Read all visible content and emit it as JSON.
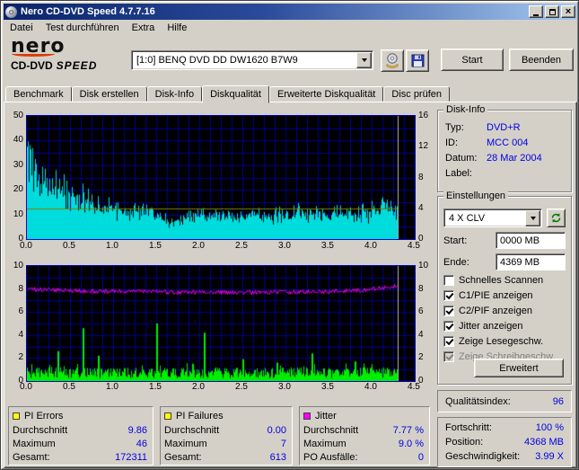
{
  "titlebar": {
    "title": "Nero CD-DVD Speed 4.7.7.16"
  },
  "menu": {
    "items": [
      "Datei",
      "Test durchführen",
      "Extra",
      "Hilfe"
    ]
  },
  "logo": {
    "brand": "nero",
    "product": "CD-DVD",
    "speed": "SPEED"
  },
  "toolbar": {
    "drive": "[1:0]   BENQ DVD DD DW1620 B7W9",
    "start": "Start",
    "quit": "Beenden"
  },
  "tabs": {
    "items": [
      "Benchmark",
      "Disk erstellen",
      "Disk-Info",
      "Diskqualität",
      "Erweiterte Diskqualität",
      "Disc prüfen"
    ],
    "active": "Diskqualität"
  },
  "disk_info": {
    "title": "Disk-Info",
    "typ_label": "Typ:",
    "typ": "DVD+R",
    "id_label": "ID:",
    "id": "MCC 004",
    "datum_label": "Datum:",
    "datum": "28 Mar 2004",
    "label_label": "Label:",
    "label": ""
  },
  "settings": {
    "title": "Einstellungen",
    "speed": "4 X CLV",
    "start_label": "Start:",
    "start": "0000 MB",
    "end_label": "Ende:",
    "end": "4369 MB",
    "checkboxes": [
      {
        "label": "Schnelles Scannen",
        "checked": false,
        "disabled": false
      },
      {
        "label": "C1/PIE anzeigen",
        "checked": true,
        "disabled": false
      },
      {
        "label": "C2/PIF anzeigen",
        "checked": true,
        "disabled": false
      },
      {
        "label": "Jitter anzeigen",
        "checked": true,
        "disabled": false
      },
      {
        "label": "Zeige Lesegeschw.",
        "checked": true,
        "disabled": false
      },
      {
        "label": "Zeige Schreibgeschw.",
        "checked": true,
        "disabled": true
      }
    ],
    "advanced": "Erweitert"
  },
  "quality": {
    "label": "Qualitätsindex:",
    "value": "96"
  },
  "progress": {
    "rows": [
      {
        "label": "Fortschritt:",
        "value": "100 %"
      },
      {
        "label": "Position:",
        "value": "4368 MB"
      },
      {
        "label": "Geschwindigkeit:",
        "value": "3.99 X"
      }
    ]
  },
  "stats": {
    "panels": [
      {
        "title": "PI Errors",
        "color": "#ffff00",
        "rows": [
          {
            "label": "Durchschnitt",
            "value": "9.86"
          },
          {
            "label": "Maximum",
            "value": "46"
          },
          {
            "label": "Gesamt:",
            "value": "172311"
          }
        ]
      },
      {
        "title": "PI Failures",
        "color": "#ffff00",
        "rows": [
          {
            "label": "Durchschnitt",
            "value": "0.00"
          },
          {
            "label": "Maximum",
            "value": "7"
          },
          {
            "label": "Gesamt:",
            "value": "613"
          }
        ]
      },
      {
        "title": "Jitter",
        "color": "#ff00ff",
        "rows": [
          {
            "label": "Durchschnitt",
            "value": "7.77 %"
          },
          {
            "label": "Maximum",
            "value": "9.0 %"
          },
          {
            "label": "PO Ausfälle:",
            "value": "0"
          }
        ]
      }
    ]
  },
  "chart_data": [
    {
      "type": "area",
      "series": "PI Errors (PIE)",
      "color": "#00dcdc",
      "grid_color": "#000092",
      "x_range": [
        0,
        4.5
      ],
      "x_ticks": [
        "0.0",
        "0.5",
        "1.0",
        "1.5",
        "2.0",
        "2.5",
        "3.0",
        "3.5",
        "4.0",
        "4.5"
      ],
      "y_left_range": [
        0,
        50
      ],
      "y_left_ticks": [
        "50",
        "40",
        "30",
        "20",
        "10",
        "0"
      ],
      "y_right_range": [
        0,
        16
      ],
      "y_right_ticks": [
        "16",
        "12",
        "8",
        "4",
        "0"
      ],
      "read_speed_line": {
        "value": 4,
        "axis": "right",
        "color": "#7f7f00",
        "label": "4 X CLV"
      },
      "scan_end_x": 4.3,
      "envelope": [
        [
          0,
          46
        ],
        [
          0.05,
          41
        ],
        [
          0.1,
          37
        ],
        [
          0.2,
          32
        ],
        [
          0.3,
          29
        ],
        [
          0.4,
          27
        ],
        [
          0.5,
          25
        ],
        [
          0.6,
          23
        ],
        [
          0.7,
          22
        ],
        [
          0.8,
          20
        ],
        [
          0.9,
          18
        ],
        [
          1.0,
          17
        ],
        [
          1.1,
          16
        ],
        [
          1.25,
          15
        ],
        [
          1.4,
          15
        ],
        [
          1.55,
          13
        ],
        [
          1.65,
          9
        ],
        [
          1.75,
          10
        ],
        [
          1.85,
          12
        ],
        [
          2.0,
          13
        ],
        [
          2.2,
          14
        ],
        [
          2.4,
          13
        ],
        [
          2.6,
          14
        ],
        [
          2.8,
          13
        ],
        [
          3.0,
          14
        ],
        [
          3.2,
          15
        ],
        [
          3.4,
          14
        ],
        [
          3.6,
          15
        ],
        [
          3.8,
          14
        ],
        [
          4.0,
          15
        ],
        [
          4.1,
          16
        ],
        [
          4.2,
          17
        ],
        [
          4.3,
          14
        ]
      ],
      "average": 9.86,
      "maximum": 46,
      "total": 172311
    },
    {
      "type": "line-bars",
      "series": "Jitter / PI Failures",
      "grid_color": "#000092",
      "x_range": [
        0,
        4.5
      ],
      "x_ticks": [
        "0.0",
        "0.5",
        "1.0",
        "1.5",
        "2.0",
        "2.5",
        "3.0",
        "3.5",
        "4.0",
        "4.5"
      ],
      "y_left_range": [
        0,
        10
      ],
      "y_left_ticks": [
        "10",
        "8",
        "6",
        "4",
        "2",
        "0"
      ],
      "y_right_range": [
        0,
        10
      ],
      "y_right_ticks": [
        "10",
        "8",
        "6",
        "4",
        "2",
        "0"
      ],
      "scan_end_x": 4.3,
      "jitter": {
        "color": "#ff00ff",
        "average": 7.77,
        "maximum": 9.0,
        "points": [
          [
            0,
            8.0
          ],
          [
            0.3,
            7.9
          ],
          [
            0.7,
            7.8
          ],
          [
            1.2,
            7.8
          ],
          [
            1.7,
            7.7
          ],
          [
            2.2,
            7.7
          ],
          [
            2.7,
            7.7
          ],
          [
            3.2,
            7.75
          ],
          [
            3.6,
            7.8
          ],
          [
            3.9,
            7.9
          ],
          [
            4.1,
            8.1
          ],
          [
            4.3,
            8.3
          ]
        ]
      },
      "pif": {
        "color": "#00ee00",
        "average": 0.0,
        "maximum": 7,
        "total": 613,
        "base_max": 1.3,
        "spikes": [
          [
            0.35,
            2.6
          ],
          [
            0.65,
            4.6
          ],
          [
            0.82,
            2.2
          ],
          [
            1.5,
            5.0
          ],
          [
            2.05,
            4.2
          ],
          [
            2.5,
            1.9
          ],
          [
            2.9,
            1.6
          ],
          [
            3.3,
            2.4
          ],
          [
            3.8,
            1.7
          ]
        ]
      }
    }
  ]
}
